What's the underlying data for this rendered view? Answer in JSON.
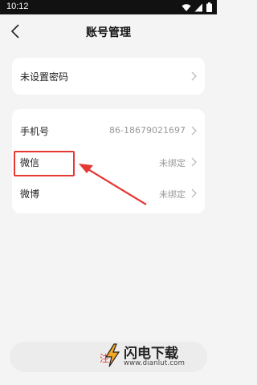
{
  "status_bar": {
    "time": "10:12",
    "icons": [
      "wifi-icon",
      "signal-icon",
      "battery-icon"
    ]
  },
  "header": {
    "back_icon": "chevron-left-icon",
    "title": "账号管理"
  },
  "password_card": {
    "label": "未设置密码"
  },
  "bindings": [
    {
      "label": "手机号",
      "value": "86-18679021697"
    },
    {
      "label": "微信",
      "value": "未绑定"
    },
    {
      "label": "微博",
      "value": "未绑定"
    }
  ],
  "bottom_action": {
    "label": "注"
  },
  "watermark": {
    "brand": "闪电下载",
    "url": "www.dianlut.com"
  },
  "colors": {
    "accent": "#e53935",
    "background": "#f4f4f4",
    "card": "#ffffff",
    "muted_text": "#999999"
  }
}
